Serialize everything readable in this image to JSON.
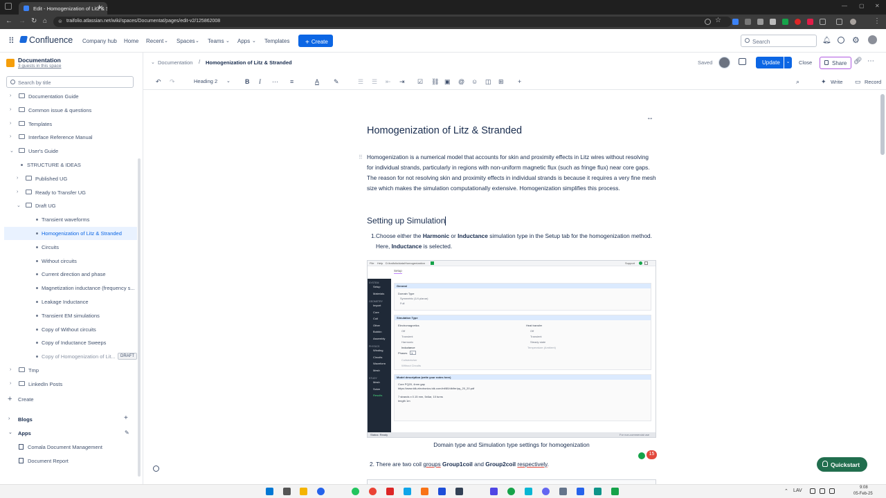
{
  "browser": {
    "tab_title": "Edit - Homogenization of Litz & Stranded",
    "url": "traifolio.atlassian.net/wiki/spaces/Documentat/pages/edit-v2/125862008"
  },
  "topnav": {
    "brand": "Confluence",
    "items": [
      "Company hub",
      "Home",
      "Recent",
      "Spaces",
      "Teams",
      "Apps",
      "Templates"
    ],
    "create_label": "Create",
    "search_placeholder": "Search"
  },
  "sidebar": {
    "space_name": "Documentation",
    "space_sub": "3 guests in this space",
    "filter_placeholder": "Search by title",
    "tree": [
      {
        "label": "Documentation Guide",
        "kind": "folder",
        "chev": "›",
        "indent": 0
      },
      {
        "label": "Common issue & questions",
        "kind": "folder",
        "chev": "›",
        "indent": 0
      },
      {
        "label": "Templates",
        "kind": "folder",
        "chev": "›",
        "indent": 0
      },
      {
        "label": "Interface Reference Manual",
        "kind": "folder",
        "chev": "›",
        "indent": 0
      },
      {
        "label": "User's Guide",
        "kind": "folder",
        "chev": "⌄",
        "indent": 0
      },
      {
        "label": "STRUCTURE & IDEAS",
        "kind": "page",
        "chev": "",
        "indent": 1
      },
      {
        "label": "Published UG",
        "kind": "folder",
        "chev": "›",
        "indent": 1
      },
      {
        "label": "Ready to Transfer UG",
        "kind": "folder",
        "chev": "›",
        "indent": 1
      },
      {
        "label": "Draft UG",
        "kind": "folder",
        "chev": "⌄",
        "indent": 1
      },
      {
        "label": "Transient waveforms",
        "kind": "page",
        "chev": "",
        "indent": 2
      },
      {
        "label": "Homogenization of Litz & Stranded",
        "kind": "page",
        "chev": "",
        "indent": 2,
        "selected": true
      },
      {
        "label": "Circuits",
        "kind": "page",
        "chev": "",
        "indent": 2
      },
      {
        "label": "Without circuits",
        "kind": "page",
        "chev": "",
        "indent": 2
      },
      {
        "label": "Current direction and phase",
        "kind": "page",
        "chev": "",
        "indent": 2
      },
      {
        "label": "Magnetization inductance (frequency s...",
        "kind": "page",
        "chev": "",
        "indent": 2
      },
      {
        "label": "Leakage Inductance",
        "kind": "page",
        "chev": "",
        "indent": 2
      },
      {
        "label": "Transient EM simulations",
        "kind": "page",
        "chev": "",
        "indent": 2
      },
      {
        "label": "Copy of Without circuits",
        "kind": "page",
        "chev": "",
        "indent": 2
      },
      {
        "label": "Copy of Inductance Sweeps",
        "kind": "page",
        "chev": "",
        "indent": 2
      },
      {
        "label": "Copy of Homogenization of Lit...",
        "kind": "page",
        "chev": "",
        "indent": 2,
        "draft": "DRAFT"
      },
      {
        "label": "Tmp",
        "kind": "folder",
        "chev": "›",
        "indent": 0
      },
      {
        "label": "LinkedIn Posts",
        "kind": "folder",
        "chev": "›",
        "indent": 0
      }
    ],
    "create_label": "Create",
    "blogs_label": "Blogs",
    "apps_label": "Apps",
    "apps": [
      "Comala Document Management",
      "Document Report"
    ]
  },
  "editor": {
    "breadcrumb_parent": "Documentation",
    "breadcrumb_current": "Homogenization of Litz & Stranded",
    "saved_label": "Saved",
    "update_label": "Update",
    "close_label": "Close",
    "share_label": "Share",
    "heading_select": "Heading 2",
    "write_label": "Write",
    "record_label": "Record"
  },
  "page": {
    "title": "Homogenization of Litz & Stranded",
    "intro": "Homogenization is a numerical model that accounts for skin and proximity effects in Litz wires without resolving for individual strands, particularly in regions with non-uniform magnetic flux (such as fringe flux) near core gaps. The reason for not resolving skin and proximity effects in individual strands is because it requires a very fine mesh size which makes the simulation computationally extensive. Homogenization simplifies this process.",
    "section_title": "Setting up Simulation",
    "step1_a": "Choose either the ",
    "step1_b": "Harmonic",
    "step1_c": " or ",
    "step1_d": "Inductance",
    "step1_e": " simulation type in the Setup tab for the homogenization method. Here, ",
    "step1_f": "Inductance",
    "step1_g": " is selected.",
    "caption": "Domain type and Simulation type settings for homogenization",
    "step2_a": "2. There are two coil ",
    "step2_b": "groups",
    "step2_c": " ",
    "step2_d": "Group1coil",
    "step2_e": " and ",
    "step2_f": "Group2coil",
    "step2_g": " ",
    "step2_h": "respectively",
    "step2_i": "."
  },
  "figure": {
    "menu": [
      "File",
      "Help"
    ],
    "path": "D:/traifolio/data/Homogenization",
    "support": "Support",
    "setup_tab": "Setup",
    "nav_groups": [
      {
        "head": "SYSTEM",
        "items": [
          "Setup",
          "Materials"
        ]
      },
      {
        "head": "GEOMETRY",
        "items": [
          "Import",
          "Core",
          "Coil",
          "Other",
          "Bobbin",
          "Assembly"
        ]
      },
      {
        "head": "PHYSICS",
        "items": [
          "Winding",
          "Circuits",
          "Waveform",
          "Mesh"
        ]
      },
      {
        "head": "STUDY",
        "items": [
          "Mesh",
          "Solve",
          "Results"
        ]
      }
    ],
    "general_label": "General",
    "domain_type_label": "Domain Type",
    "domain_options": [
      "Symmetric (1/4 planar)",
      "Full"
    ],
    "sim_type_label": "Simulation Type",
    "em_label": "Electromagnetics",
    "em_options": [
      "Off",
      "Transient",
      "Harmonic",
      "Inductance"
    ],
    "phases_label": "Phases",
    "phases_value": "1",
    "em_extra": [
      "Coilstretcher",
      "Without Circuits"
    ],
    "heat_label": "Heat transfer",
    "heat_options": [
      "Off",
      "Transient",
      "Steady state"
    ],
    "temp_label": "Temperature (Ambient)",
    "model_desc_label": "Model description (write your notes here)",
    "model_desc_lines": [
      "Core PQ20, 4mm gap",
      "https://www.tdk-electronics.tdk.com/inf/80/db/fer/pq_20_20.pdf",
      "",
      "7 strands x 0.15 mm, 5x6ar, 10 turns",
      "length 1m"
    ],
    "status": "Status: Ready",
    "license": "For non-commercial use"
  },
  "misc": {
    "quickstart": "Quickstart",
    "badge_count": "15",
    "clock_time": "9:08",
    "clock_date": "05-Feb-25",
    "lang": "LAV"
  },
  "colors": {
    "primary": "#0c66e4",
    "quickstart": "#216e4e",
    "share_border": "#af59e1",
    "selected_bg": "#e9f2ff"
  }
}
